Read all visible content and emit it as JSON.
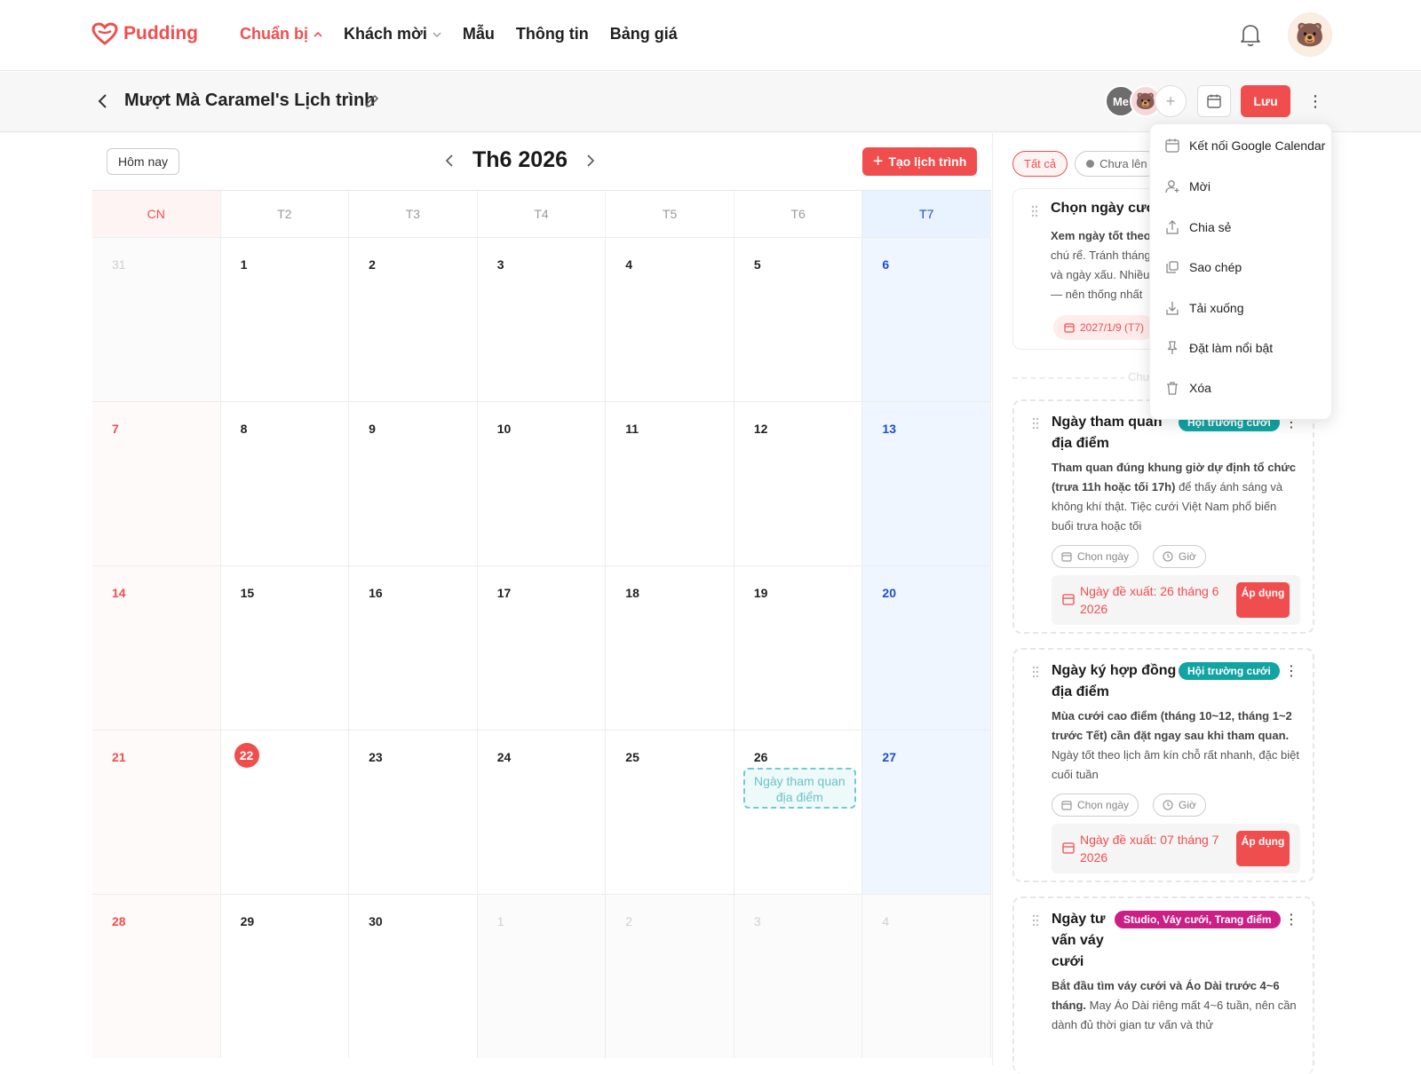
{
  "brand": {
    "name": "Pudding",
    "color": "#f04e4e"
  },
  "nav": [
    {
      "label": "Chuẩn bị",
      "active": true,
      "has_chevron": true
    },
    {
      "label": "Khách mời",
      "active": false,
      "has_chevron": true
    },
    {
      "label": "Mẫu",
      "active": false,
      "has_chevron": false
    },
    {
      "label": "Thông tin",
      "active": false,
      "has_chevron": false
    },
    {
      "label": "Bảng giá",
      "active": false,
      "has_chevron": false
    }
  ],
  "header": {
    "title": "Mượt Mà Caramel's Lịch trình",
    "member_me": "Me",
    "save_label": "Lưu"
  },
  "calendar": {
    "today_label": "Hôm nay",
    "month_label": "Th6 2026",
    "create_label": "Tạo lịch trình",
    "weekdays": [
      "CN",
      "T2",
      "T3",
      "T4",
      "T5",
      "T6",
      "T7"
    ],
    "days": [
      [
        "31",
        "other"
      ],
      [
        "1",
        ""
      ],
      [
        "2",
        ""
      ],
      [
        "3",
        ""
      ],
      [
        "4",
        ""
      ],
      [
        "5",
        ""
      ],
      [
        "6",
        ""
      ],
      [
        "7",
        ""
      ],
      [
        "8",
        ""
      ],
      [
        "9",
        ""
      ],
      [
        "10",
        ""
      ],
      [
        "11",
        ""
      ],
      [
        "12",
        ""
      ],
      [
        "13",
        ""
      ],
      [
        "14",
        ""
      ],
      [
        "15",
        ""
      ],
      [
        "16",
        ""
      ],
      [
        "17",
        ""
      ],
      [
        "18",
        ""
      ],
      [
        "19",
        ""
      ],
      [
        "20",
        ""
      ],
      [
        "21",
        ""
      ],
      [
        "22",
        "today"
      ],
      [
        "23",
        ""
      ],
      [
        "24",
        ""
      ],
      [
        "25",
        ""
      ],
      [
        "26",
        ""
      ],
      [
        "27",
        ""
      ],
      [
        "28",
        ""
      ],
      [
        "29",
        ""
      ],
      [
        "30",
        ""
      ],
      [
        "1",
        "other"
      ],
      [
        "2",
        "other"
      ],
      [
        "3",
        "other"
      ],
      [
        "4",
        "other"
      ]
    ],
    "event": {
      "day": "26",
      "label": "Ngày tham quan địa điểm"
    }
  },
  "filters": {
    "all": "Tất cả",
    "unscheduled": "Chưa lên"
  },
  "cards": [
    {
      "title": "Chọn ngày cưới",
      "desc_bold": "Xem ngày tốt theo",
      "desc_lines": [
        "chú rể. Tránh tháng",
        "và ngày xấu. Nhiều",
        "— nên thống nhất"
      ],
      "date": "2027/1/9 (T7)"
    }
  ],
  "separator_label": "Chư",
  "tasks": [
    {
      "title_lines": [
        "Ngày tham quan",
        "địa điểm"
      ],
      "tag": "Hội trường cưới",
      "desc_bold": "Tham quan đúng khung giờ dự định tổ chức (trưa 11h hoặc tối 17h)",
      "desc_rest": " để thấy ánh sáng và không khí thật. Tiệc cưới Việt Nam phổ biến buổi trưa hoặc tối",
      "pick_date": "Chọn ngày",
      "pick_time": "Giờ",
      "suggest": "Ngày đề xuất: 26 tháng 6 2026",
      "apply": "Áp dụng"
    },
    {
      "title_lines": [
        "Ngày ký hợp đồng",
        "địa điểm"
      ],
      "tag": "Hội trường cưới",
      "desc_bold": "Mùa cưới cao điểm (tháng 10~12, tháng 1~2 trước Tết) cần đặt ngay sau khi tham quan.",
      "desc_rest": " Ngày tốt theo lịch âm kín chỗ rất nhanh, đặc biệt cuối tuần",
      "pick_date": "Chọn ngày",
      "pick_time": "Giờ",
      "suggest": "Ngày đề xuất: 07 tháng 7 2026",
      "apply": "Áp dụng"
    },
    {
      "title_lines": [
        "Ngày tư",
        "vấn váy",
        "cưới"
      ],
      "tag": "Studio, Váy cưới, Trang điểm",
      "desc_bold": "Bắt đầu tìm váy cưới và Áo Dài trước 4~6 tháng.",
      "desc_rest": " May Áo Dài riêng mất 4~6 tuần, nên cần dành đủ thời gian tư vấn và thử"
    }
  ],
  "menu": [
    {
      "icon": "calendar-icon",
      "label": "Kết nối Google Calendar"
    },
    {
      "icon": "invite-user-icon",
      "label": "Mời"
    },
    {
      "icon": "share-icon",
      "label": "Chia sẻ"
    },
    {
      "icon": "copy-icon",
      "label": "Sao chép"
    },
    {
      "icon": "download-icon",
      "label": "Tải xuống"
    },
    {
      "icon": "pin-icon",
      "label": "Đặt làm nổi bật"
    },
    {
      "icon": "trash-icon",
      "label": "Xóa"
    }
  ],
  "colors": {
    "accent": "#f04e4e",
    "sunday": "#f04e4e",
    "saturday": "#1b4fd0",
    "teal_tag": "#12a3a3",
    "pink_tag": "#cc1f86",
    "event": "#74c9cf"
  }
}
